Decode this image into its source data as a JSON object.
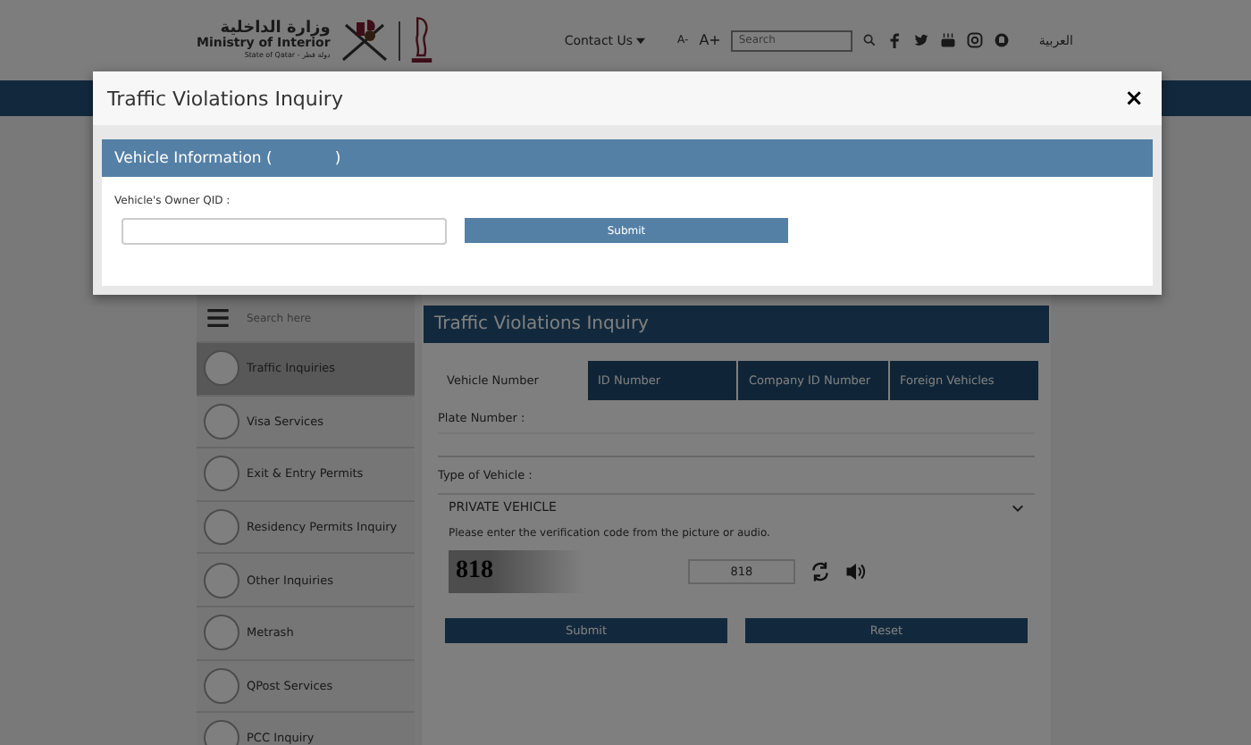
{
  "header": {
    "logo_arabic": "وزارة الداخلية",
    "logo_english": "Ministry of Interior",
    "logo_tagline": "State of Qatar - دولة قطر",
    "contact": "Contact Us",
    "font_smaller": "A-",
    "font_larger": "A+",
    "search": {
      "placeholder": "Search"
    },
    "language": "العربية"
  },
  "sidebar": {
    "search": {
      "placeholder": "Search here"
    },
    "items": [
      {
        "label": "Traffic Inquiries",
        "selected": true
      },
      {
        "label": "Visa Services",
        "selected": false
      },
      {
        "label": "Exit & Entry Permits",
        "selected": false
      },
      {
        "label": "Residency Permits Inquiry",
        "selected": false
      },
      {
        "label": "Other Inquiries",
        "selected": false
      },
      {
        "label": "Metrash",
        "selected": false
      },
      {
        "label": "QPost Services",
        "selected": false
      },
      {
        "label": "PCC Inquiry",
        "selected": false
      }
    ]
  },
  "panel": {
    "title": "Traffic Violations Inquiry",
    "tabs": [
      {
        "label": "Vehicle Number",
        "selected": true
      },
      {
        "label": "ID Number",
        "selected": false
      },
      {
        "label": "Company ID Number",
        "selected": false
      },
      {
        "label": "Foreign Vehicles",
        "selected": false
      }
    ],
    "plate_label": "Plate Number :",
    "vehicle_type_label": "Type of Vehicle :",
    "vehicle_type": "PRIVATE VEHICLE",
    "verification_hint": "Please enter the verification code from the picture or audio.",
    "captcha": "818",
    "code_value": "818",
    "buttons": [
      "Submit",
      "Reset"
    ]
  },
  "modal": {
    "title": "Traffic Violations Inquiry",
    "close": "×",
    "section_prefix": "Vehicle Information (",
    "section_suffix": ")",
    "qid_label": "Vehicle's Owner QID :",
    "submit": "Submit"
  }
}
